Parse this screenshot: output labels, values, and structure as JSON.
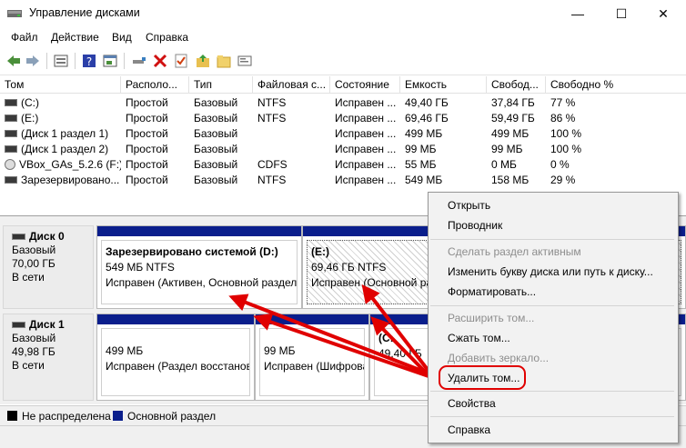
{
  "window": {
    "title": "Управление дисками",
    "minimize_glyph": "—",
    "maximize_glyph": "☐",
    "close_glyph": "✕"
  },
  "menu": {
    "file": "Файл",
    "action": "Действие",
    "view": "Вид",
    "help": "Справка"
  },
  "toolbar": {
    "icons": [
      "back-icon",
      "forward-icon",
      "disk-properties-icon",
      "help-icon",
      "console-icon",
      "connect-icon",
      "delete-icon",
      "check-icon",
      "folder-up-icon",
      "folder-icon",
      "settings-icon"
    ]
  },
  "volumes": {
    "columns": [
      "Том",
      "Располо...",
      "Тип",
      "Файловая с...",
      "Состояние",
      "Емкость",
      "Свобод...",
      "Свободно %"
    ],
    "rows": [
      [
        "(C:)",
        "Простой",
        "Базовый",
        "NTFS",
        "Исправен ...",
        "49,40 ГБ",
        "37,84 ГБ",
        "77 %"
      ],
      [
        "(E:)",
        "Простой",
        "Базовый",
        "NTFS",
        "Исправен ...",
        "69,46 ГБ",
        "59,49 ГБ",
        "86 %"
      ],
      [
        "(Диск 1 раздел 1)",
        "Простой",
        "Базовый",
        "",
        "Исправен ...",
        "499 МБ",
        "499 МБ",
        "100 %"
      ],
      [
        "(Диск 1 раздел 2)",
        "Простой",
        "Базовый",
        "",
        "Исправен ...",
        "99 МБ",
        "99 МБ",
        "100 %"
      ],
      [
        "VBox_GAs_5.2.6 (F:)",
        "Простой",
        "Базовый",
        "CDFS",
        "Исправен ...",
        "55 МБ",
        "0 МБ",
        "0 %"
      ],
      [
        "Зарезервировано...",
        "Простой",
        "Базовый",
        "NTFS",
        "Исправен ...",
        "549 МБ",
        "158 МБ",
        "29 %"
      ]
    ]
  },
  "disks": [
    {
      "name": "Диск 0",
      "type": "Базовый",
      "size": "70,00 ГБ",
      "status": "В сети",
      "partitions": [
        {
          "title": "Зарезервировано системой  (D:)",
          "line1": "549 МБ NTFS",
          "line2": "Исправен (Активен, Основной раздел"
        },
        {
          "title": "(E:)",
          "line1": "69,46 ГБ NTFS",
          "line2": "Исправен (Основной разд"
        }
      ]
    },
    {
      "name": "Диск 1",
      "type": "Базовый",
      "size": "49,98 ГБ",
      "status": "В сети",
      "partitions": [
        {
          "title": "",
          "line1": "499 МБ",
          "line2": "Исправен (Раздел восстанов"
        },
        {
          "title": "",
          "line1": "99 МБ",
          "line2": "Исправен (Шифрова"
        },
        {
          "title": "(C:",
          "line1": "49,40 ГБ",
          "line2": ""
        }
      ]
    }
  ],
  "legend": {
    "unallocated": "Не распределена",
    "primary": "Основной раздел",
    "unallocated_color": "#000000",
    "primary_color": "#0a1e8c"
  },
  "context_menu": {
    "open": "Открыть",
    "explorer": "Проводник",
    "mark_active": "Сделать раздел активным",
    "change_letter": "Изменить букву диска или путь к диску...",
    "format": "Форматировать...",
    "extend": "Расширить том...",
    "shrink": "Сжать том...",
    "add_mirror": "Добавить зеркало...",
    "delete": "Удалить том...",
    "properties": "Свойства",
    "help": "Справка"
  },
  "annotation_color": "#e00000"
}
